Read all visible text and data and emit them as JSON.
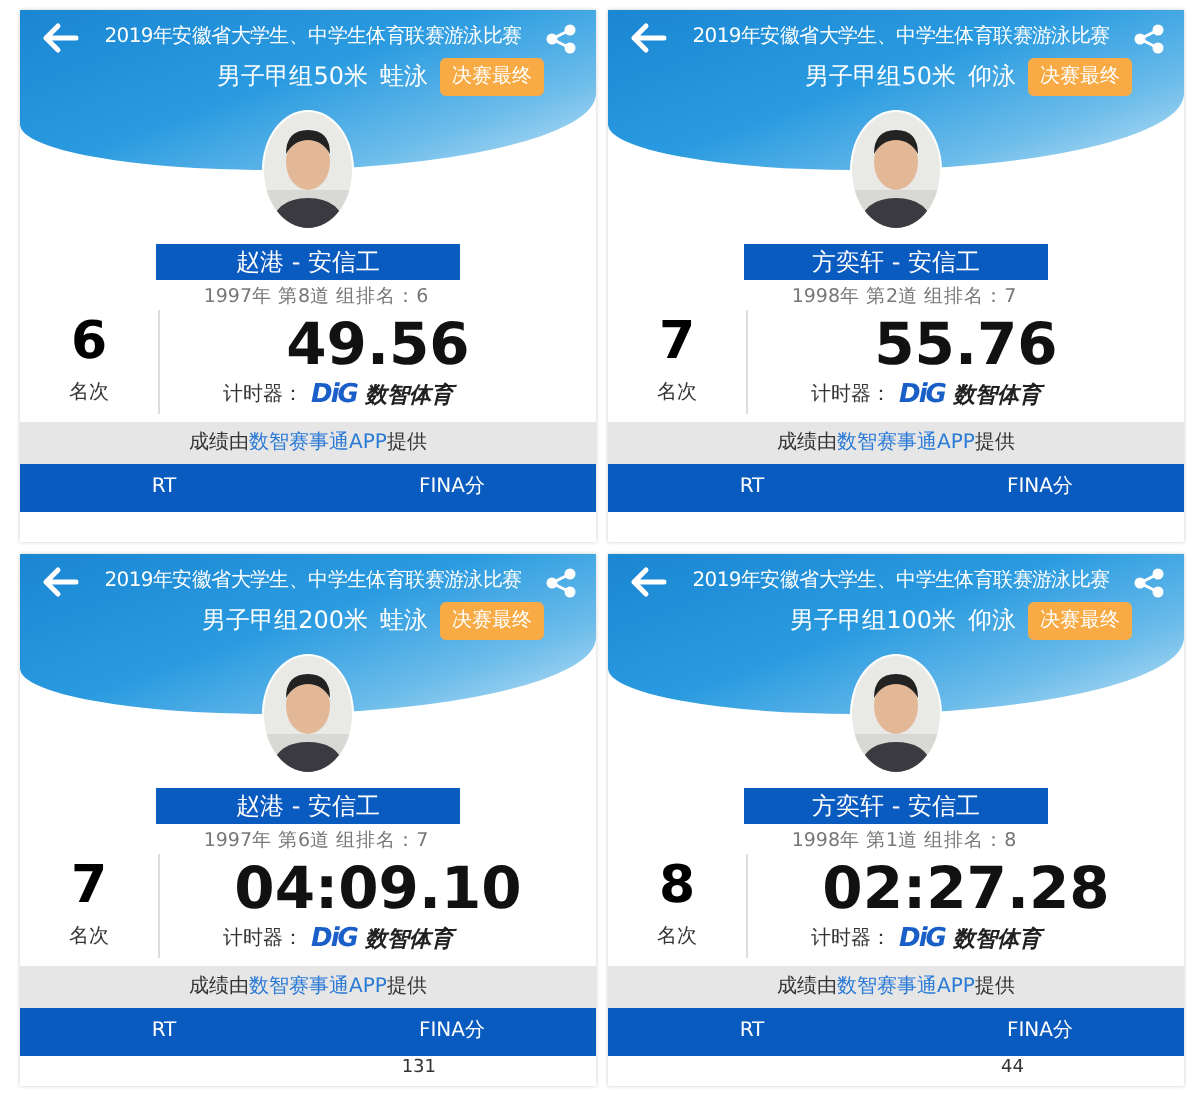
{
  "cards": [
    {
      "title": "2019年安徽省大学生、中学生体育联赛游泳比赛",
      "event": "男子甲组50米",
      "stroke": "蛙泳",
      "badge": "决赛最终",
      "athlete": "赵港 - 安信工",
      "info": "1997年 第8道 组排名：6",
      "rank": "6",
      "rank_label": "名次",
      "time": "49.56",
      "timer_label": "计时器：",
      "logo_letters": "DiG",
      "logo_text": "数智体育",
      "credit": {
        "before": "成绩由",
        "link": "数智赛事通APP",
        "after": "提供"
      },
      "columns": [
        "RT",
        "FINA分"
      ]
    },
    {
      "title": "2019年安徽省大学生、中学生体育联赛游泳比赛",
      "event": "男子甲组50米",
      "stroke": "仰泳",
      "badge": "决赛最终",
      "athlete": "方奕轩 - 安信工",
      "info": "1998年 第2道 组排名：7",
      "rank": "7",
      "rank_label": "名次",
      "time": "55.76",
      "timer_label": "计时器：",
      "logo_letters": "DiG",
      "logo_text": "数智体育",
      "credit": {
        "before": "成绩由",
        "link": "数智赛事通APP",
        "after": "提供"
      },
      "columns": [
        "RT",
        "FINA分"
      ]
    },
    {
      "title": "2019年安徽省大学生、中学生体育联赛游泳比赛",
      "event": "男子甲组200米",
      "stroke": "蛙泳",
      "badge": "决赛最终",
      "athlete": "赵港 - 安信工",
      "info": "1997年 第6道 组排名：7",
      "rank": "7",
      "rank_label": "名次",
      "time": "04:09.10",
      "timer_label": "计时器：",
      "logo_letters": "DiG",
      "logo_text": "数智体育",
      "credit": {
        "before": "成绩由",
        "link": "数智赛事通APP",
        "after": "提供"
      },
      "columns": [
        "RT",
        "FINA分"
      ],
      "value_below": "131"
    },
    {
      "title": "2019年安徽省大学生、中学生体育联赛游泳比赛",
      "event": "男子甲组100米",
      "stroke": "仰泳",
      "badge": "决赛最终",
      "athlete": "方奕轩 - 安信工",
      "info": "1998年 第1道 组排名：8",
      "rank": "8",
      "rank_label": "名次",
      "time": "02:27.28",
      "timer_label": "计时器：",
      "logo_letters": "DiG",
      "logo_text": "数智体育",
      "credit": {
        "before": "成绩由",
        "link": "数智赛事通APP",
        "after": "提供"
      },
      "columns": [
        "RT",
        "FINA分"
      ],
      "value_below": "44"
    }
  ]
}
